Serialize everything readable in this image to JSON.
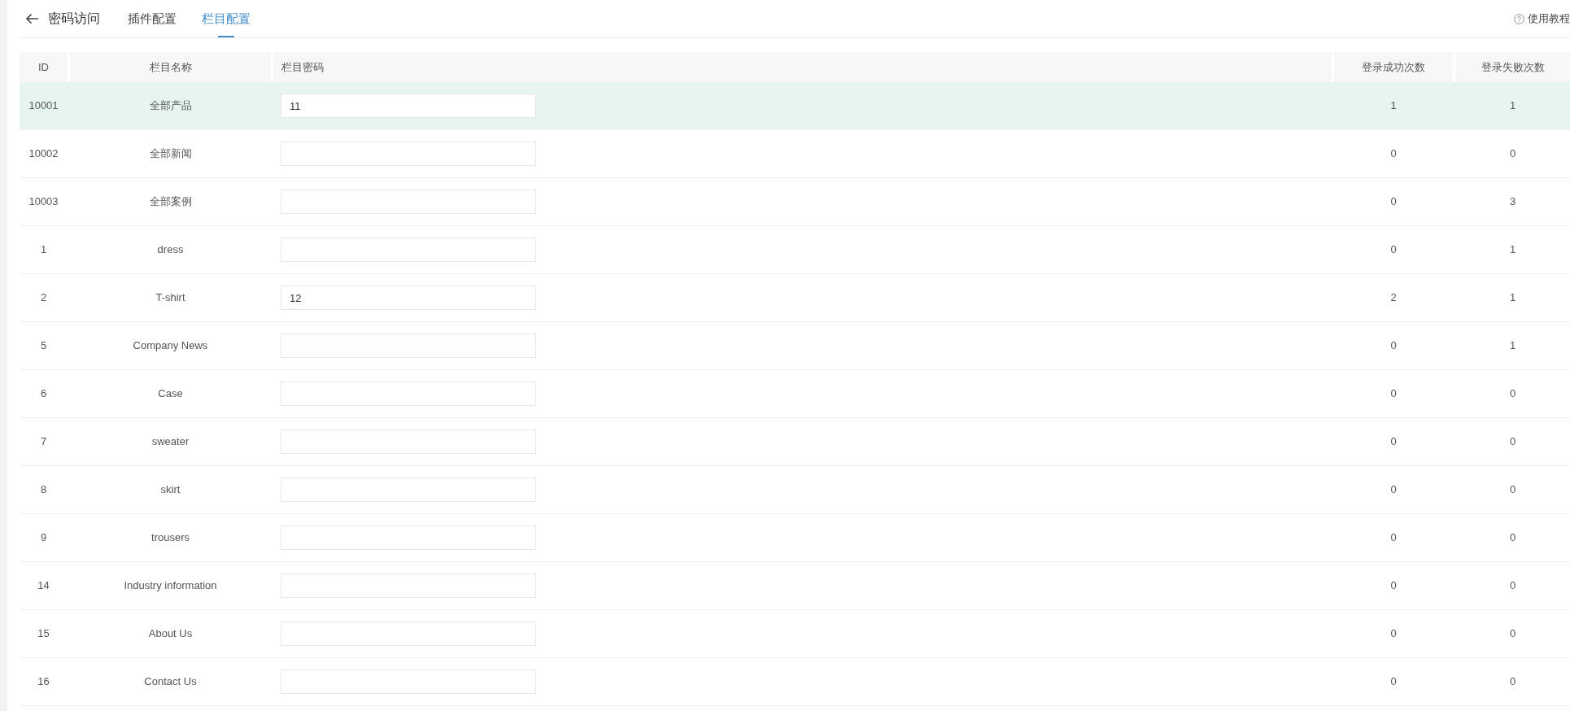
{
  "header": {
    "title": "密码访问",
    "tabs": [
      {
        "label": "插件配置",
        "selected": false
      },
      {
        "label": "栏目配置",
        "selected": true
      }
    ],
    "help_link": "使用教程"
  },
  "table": {
    "columns": [
      "ID",
      "栏目名称",
      "栏目密码",
      "登录成功次数",
      "登录失败次数"
    ],
    "rows": [
      {
        "id": "10001",
        "name": "全部产品",
        "password": "11",
        "success_count": "1",
        "failure_count": "1",
        "selected": true
      },
      {
        "id": "10002",
        "name": "全部新闻",
        "success_count": "0",
        "failure_count": "0",
        "selected": false
      },
      {
        "id": "10003",
        "name": "全部案例",
        "success_count": "0",
        "failure_count": "3",
        "selected": false
      },
      {
        "id": "1",
        "name": "dress",
        "success_count": "0",
        "failure_count": "1",
        "selected": false
      },
      {
        "id": "2",
        "name": "T-shirt",
        "password": "12",
        "success_count": "2",
        "failure_count": "1",
        "selected": false
      },
      {
        "id": "5",
        "name": "Company News",
        "success_count": "0",
        "failure_count": "1",
        "selected": false
      },
      {
        "id": "6",
        "name": "Case",
        "success_count": "0",
        "failure_count": "0",
        "selected": false
      },
      {
        "id": "7",
        "name": "sweater",
        "success_count": "0",
        "failure_count": "0",
        "selected": false
      },
      {
        "id": "8",
        "name": "skirt",
        "success_count": "0",
        "failure_count": "0",
        "selected": false
      },
      {
        "id": "9",
        "name": "trousers",
        "success_count": "0",
        "failure_count": "0",
        "selected": false
      },
      {
        "id": "14",
        "name": "Industry information",
        "success_count": "0",
        "failure_count": "0",
        "selected": false
      },
      {
        "id": "15",
        "name": "About Us",
        "success_count": "0",
        "failure_count": "0",
        "selected": false
      },
      {
        "id": "16",
        "name": "Contact Us",
        "success_count": "0",
        "failure_count": "0",
        "selected": false
      }
    ]
  }
}
